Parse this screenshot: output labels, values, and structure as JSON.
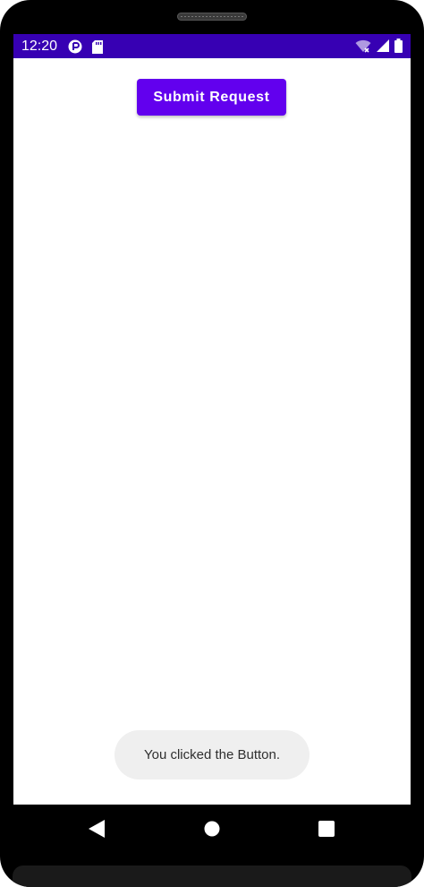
{
  "colors": {
    "status_bar": "#3700b3",
    "primary": "#6200ee",
    "toast_bg": "#efefef"
  },
  "status_bar": {
    "time": "12:20",
    "left_icons": [
      "sync-icon",
      "sd-card-icon"
    ],
    "right_icons": [
      "wifi-icon",
      "cell-signal-icon",
      "battery-icon"
    ]
  },
  "main": {
    "submit_label": "Submit Request"
  },
  "toast": {
    "message": "You clicked the Button."
  },
  "nav_bar": {
    "buttons": [
      "back-icon",
      "home-icon",
      "recents-icon"
    ]
  }
}
